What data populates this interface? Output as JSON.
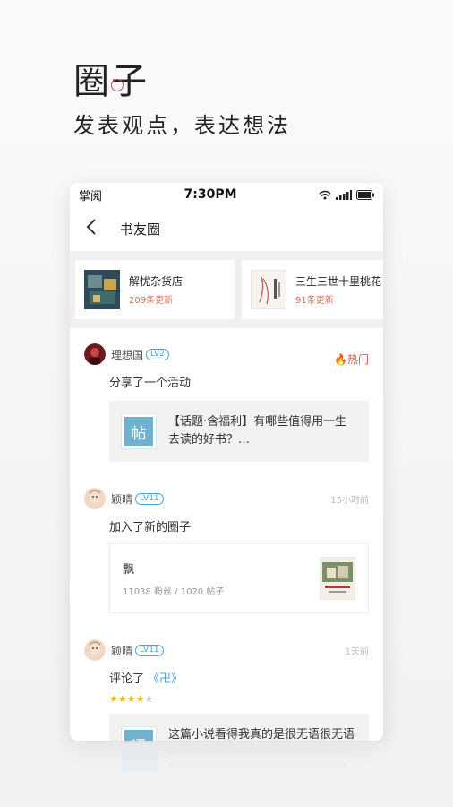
{
  "hero": {
    "title": "圈子",
    "subtitle": "发表观点，表达想法"
  },
  "status_bar": {
    "carrier": "掌阅",
    "time": "7:30PM"
  },
  "nav": {
    "title": "书友圈"
  },
  "circles": [
    {
      "name": "解忧杂货店",
      "update": "209条更新"
    },
    {
      "name": "三生三世十里桃花",
      "update": "91条更新"
    }
  ],
  "feed": [
    {
      "username": "理想国",
      "level": "LV2",
      "hot_label": "热门",
      "action": "分享了一个活动",
      "embed_tag": "帖",
      "embed_text": "【话题·含福利】有哪些值得用一生去读的好书？…"
    },
    {
      "username": "颖晴",
      "level": "LV11",
      "time": "15小时前",
      "action": "加入了新的圈子",
      "circle_name": "飘",
      "circle_stats": "11038 粉丝 / 1020 帖子"
    },
    {
      "username": "颖晴",
      "level": "LV11",
      "time": "1天前",
      "action": "评论了",
      "book": "《卍》",
      "rating": 4,
      "embed_tag": "评",
      "embed_text": "这篇小说看得我真的是很无语很无语啊，觉得是各种畸形变态…… …"
    }
  ]
}
